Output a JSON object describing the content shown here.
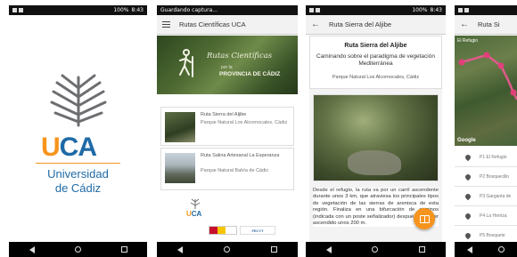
{
  "screens": {
    "splash": {
      "status": {
        "time": "8:43",
        "battery": "100%"
      },
      "logo": {
        "u": "U",
        "ca": "CA"
      },
      "name_line1": "Universidad",
      "name_line2": "de Cádiz"
    },
    "list": {
      "status": {
        "left_text": "Guardando captura...",
        "time": "",
        "battery": ""
      },
      "title": "Rutas Científicas UCA",
      "banner": {
        "title": "Rutas Científicas",
        "subtitle": "por la",
        "province": "PROVINCIA DE CÁDIZ"
      },
      "routes": [
        {
          "title": "Ruta Sierra del Aljibe",
          "place": "Parque Natural Los Alcornocales, Cádiz"
        },
        {
          "title": "Ruta Salina Artesanal La Esperanza",
          "place": "Parque Natural Bahía de Cádiz"
        }
      ],
      "sponsors": {
        "uca_u": "U",
        "uca_ca": "CA",
        "logo2": "FECYT"
      }
    },
    "detail": {
      "status": {
        "time": "8:43",
        "battery": "100%"
      },
      "appbar_title": "Ruta Sierra del Aljibe",
      "title": "Ruta Sierra del Aljibe",
      "subtitle": "Caminando sobre el paradigma de vegetación Mediterránea",
      "place": "Parque Natural Los Alcornocales, Cádiz",
      "text": "Desde el refugio, la ruta va por un carril ascendente durante unos 3 km, que atraviesa los principales tipos de vegetación de las sierras de arenisca de esta región. Finaliza en una bifurcación de caminos (indicada con un poste señalizador) después de haber ascendido unos 200 m."
    },
    "map": {
      "appbar_title": "Ruta Si",
      "map_label": "El Refugio",
      "google": "Google",
      "points": [
        "P1 El Refugio",
        "P2 Bosquecillo",
        "P3 Garganta de",
        "P4 La Herriza",
        "P5 Bosquete"
      ]
    }
  }
}
